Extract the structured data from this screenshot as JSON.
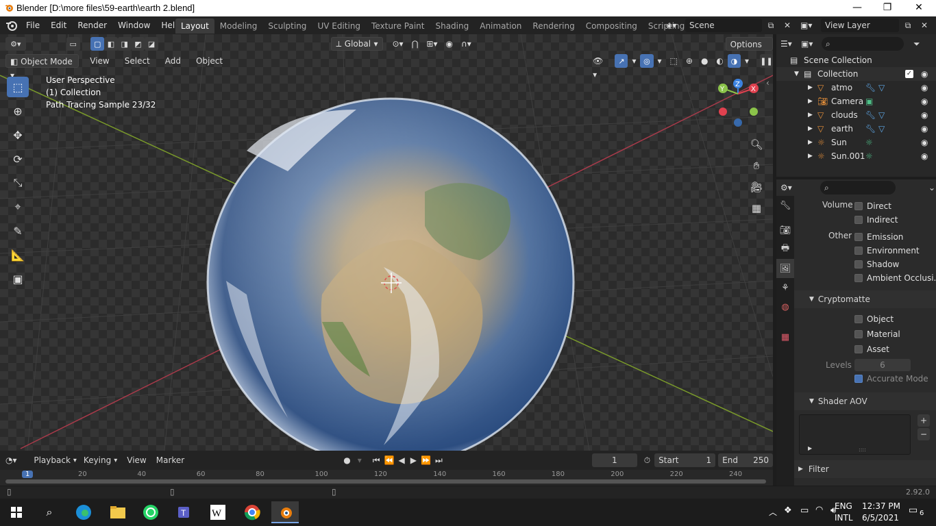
{
  "window": {
    "title": "Blender [D:\\more files\\59-earth\\earth 2.blend]",
    "minimize": "—",
    "maximize": "❐",
    "close": "✕"
  },
  "menu": {
    "items": [
      "File",
      "Edit",
      "Render",
      "Window",
      "Help"
    ]
  },
  "workspaces": [
    "Layout",
    "Modeling",
    "Sculpting",
    "UV Editing",
    "Texture Paint",
    "Shading",
    "Animation",
    "Rendering",
    "Compositing",
    "Scripting"
  ],
  "active_workspace": "Layout",
  "scene": {
    "name": "Scene",
    "view_layer": "View Layer"
  },
  "viewport": {
    "transform_orientation": "Global",
    "options_label": "Options",
    "mode": "Object Mode",
    "header_menu": [
      "View",
      "Select",
      "Add",
      "Object"
    ],
    "overlay_lines": [
      "User Perspective",
      "(1) Collection",
      "Path Tracing Sample 23/32"
    ],
    "gizmo_axes": {
      "x": "X",
      "y": "Y",
      "z": "Z"
    }
  },
  "outliner": {
    "root": "Scene Collection",
    "collection": "Collection",
    "objects": [
      {
        "name": "atmo",
        "type": "mesh"
      },
      {
        "name": "Camera",
        "type": "camera"
      },
      {
        "name": "clouds",
        "type": "mesh"
      },
      {
        "name": "earth",
        "type": "mesh"
      },
      {
        "name": "Sun",
        "type": "light"
      },
      {
        "name": "Sun.001",
        "type": "light"
      }
    ]
  },
  "properties": {
    "volume_label": "Volume",
    "volume_passes": [
      {
        "label": "Direct",
        "checked": false
      },
      {
        "label": "Indirect",
        "checked": false
      }
    ],
    "other_label": "Other",
    "other_passes": [
      {
        "label": "Emission",
        "checked": false
      },
      {
        "label": "Environment",
        "checked": false
      },
      {
        "label": "Shadow",
        "checked": false
      },
      {
        "label": "Ambient Occlusi...",
        "checked": false
      }
    ],
    "cryptomatte_title": "Cryptomatte",
    "cryptomatte": [
      {
        "label": "Object",
        "checked": false
      },
      {
        "label": "Material",
        "checked": false
      },
      {
        "label": "Asset",
        "checked": false
      }
    ],
    "levels_label": "Levels",
    "levels_value": "6",
    "accurate_mode": {
      "label": "Accurate Mode",
      "checked": true
    },
    "shader_aov_title": "Shader AOV",
    "filter_title": "Filter",
    "list_grip": "::::",
    "add_symbol": "+",
    "remove_symbol": "−"
  },
  "timeline": {
    "menus": [
      "Playback",
      "Keying",
      "View",
      "Marker"
    ],
    "current_frame": "1",
    "start_label": "Start",
    "start_value": "1",
    "end_label": "End",
    "end_value": "250",
    "ruler_ticks": [
      "1",
      "20",
      "40",
      "60",
      "80",
      "100",
      "120",
      "140",
      "160",
      "180",
      "200",
      "220",
      "240"
    ]
  },
  "status": {
    "version": "2.92.0"
  },
  "taskbar": {
    "lang1": "ENG",
    "lang2": "INTL",
    "time": "12:37 PM",
    "date": "6/5/2021",
    "notifications": "6",
    "apps": [
      "windows-start",
      "search",
      "edge",
      "file-explorer",
      "whatsapp",
      "teams",
      "wikipedia",
      "chrome",
      "blender"
    ]
  },
  "colors": {
    "accent": "#4772b3",
    "mesh_icon": "#e8913a",
    "data_icon": "#4fc38a",
    "light_icon": "#e8c13a",
    "axis_x": "#e0414f",
    "axis_y": "#8bc34a",
    "axis_z": "#3b82e0"
  }
}
